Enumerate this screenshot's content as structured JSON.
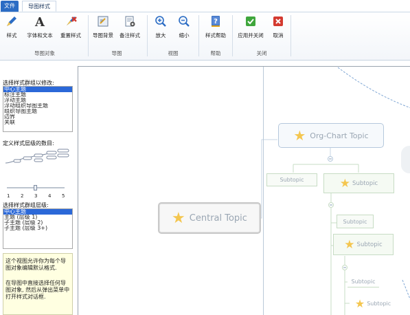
{
  "tabs": [
    {
      "label": "文件",
      "active": false
    },
    {
      "label": "导图样式",
      "active": true
    }
  ],
  "ribbon": {
    "groups": {
      "object": "导图对象",
      "map": "导图",
      "view": "视图",
      "help": "帮助",
      "close": "关闭"
    },
    "buttons": {
      "style": "样式",
      "font": "字体和文本",
      "reset": "重置样式",
      "background": "导图背景",
      "note_style": "备注样式",
      "zoom_in": "放大",
      "zoom_out": "缩小",
      "style_help": "样式帮助",
      "apply_close": "应用并关闭",
      "cancel": "取消"
    }
  },
  "left_panel": {
    "select_group_label": "选择样式群组以修改:",
    "groups_list": [
      "中心主题",
      "标注主题",
      "浮动主题",
      "浮动组织导图主题",
      "组织导图主题",
      "边界",
      "关联"
    ],
    "groups_selected": 0,
    "levels_label": "定义样式层级的数目:",
    "level_ticks": [
      "1",
      "2",
      "3",
      "4",
      "5"
    ],
    "slider_value": 3,
    "select_level_label": "选择样式群组层级:",
    "levels_list": [
      "中心主题",
      "主题 (层级 1)",
      "子主题 (层级 2)",
      "子主题 (层级 3+)"
    ],
    "levels_selected": 0,
    "help_para1": "这个视图允许你为每个导图对象编辑默认格式.",
    "help_para2": "在导图中直接选择任何导图对象, 然后从弹出菜单中打开样式对话框."
  },
  "canvas": {
    "central_topic": "Central Topic",
    "org_chart_topic": "Org-Chart Topic",
    "subtopics": [
      "Subtopic",
      "Subtopic",
      "Subtopic",
      "Subtopic",
      "Subtopic",
      "Subtopic"
    ]
  },
  "colors": {
    "accent": "#2b6cc4",
    "selection": "#2b68d8",
    "topic_border": "#b5c8dc",
    "subtopic_border": "#c7dcc4",
    "star": "#f4c64f",
    "help_bg": "#ffffe1"
  },
  "icons": [
    "pen-icon",
    "font-a-icon",
    "reset-style-icon",
    "map-background-icon",
    "note-style-icon",
    "zoom-in-icon",
    "zoom-out-icon",
    "help-book-icon",
    "apply-check-icon",
    "cancel-x-icon",
    "star-icon"
  ]
}
